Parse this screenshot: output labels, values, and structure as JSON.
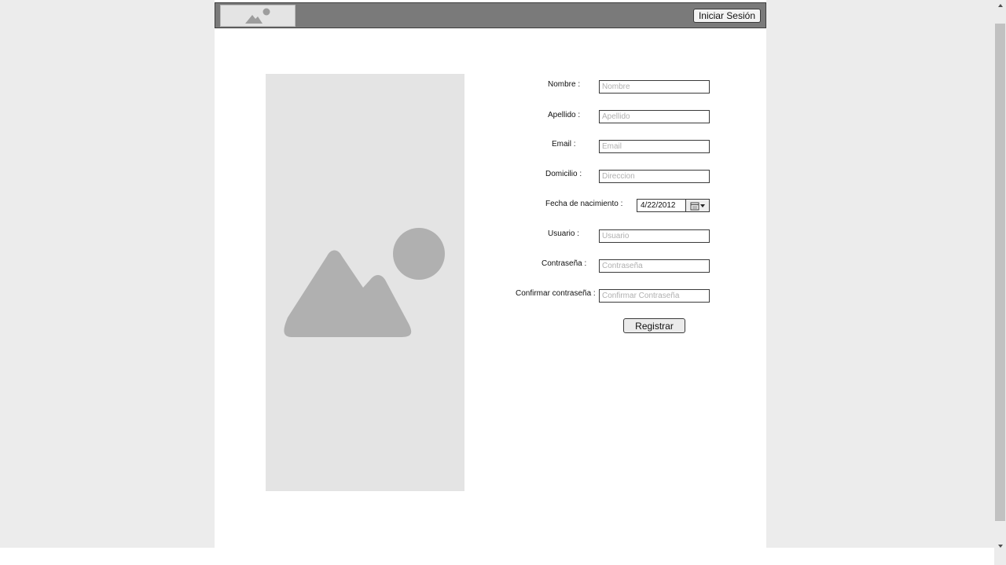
{
  "header": {
    "logo_icon": "image-placeholder-icon",
    "login_label": "Iniciar Sesión"
  },
  "hero": {
    "icon": "image-placeholder-icon"
  },
  "form": {
    "nombre": {
      "label": "Nombre :",
      "placeholder": "Nombre",
      "value": ""
    },
    "apellido": {
      "label": "Apellido :",
      "placeholder": "Apellido",
      "value": ""
    },
    "email": {
      "label": "Email :",
      "placeholder": "Email",
      "value": ""
    },
    "domicilio": {
      "label": "Domicilio :",
      "placeholder": "Direccion",
      "value": ""
    },
    "fecha": {
      "label": "Fecha de nacimiento :",
      "value": "4/22/2012",
      "icon": "calendar-dropdown-icon"
    },
    "usuario": {
      "label": "Usuario :",
      "placeholder": "Usuario",
      "value": ""
    },
    "contrasena": {
      "label": "Contraseña :",
      "placeholder": "Contraseña",
      "value": ""
    },
    "confirmar": {
      "label": "Confirmar contraseña :",
      "placeholder": "Confirmar Contraseña",
      "value": ""
    },
    "submit_label": "Registrar"
  }
}
